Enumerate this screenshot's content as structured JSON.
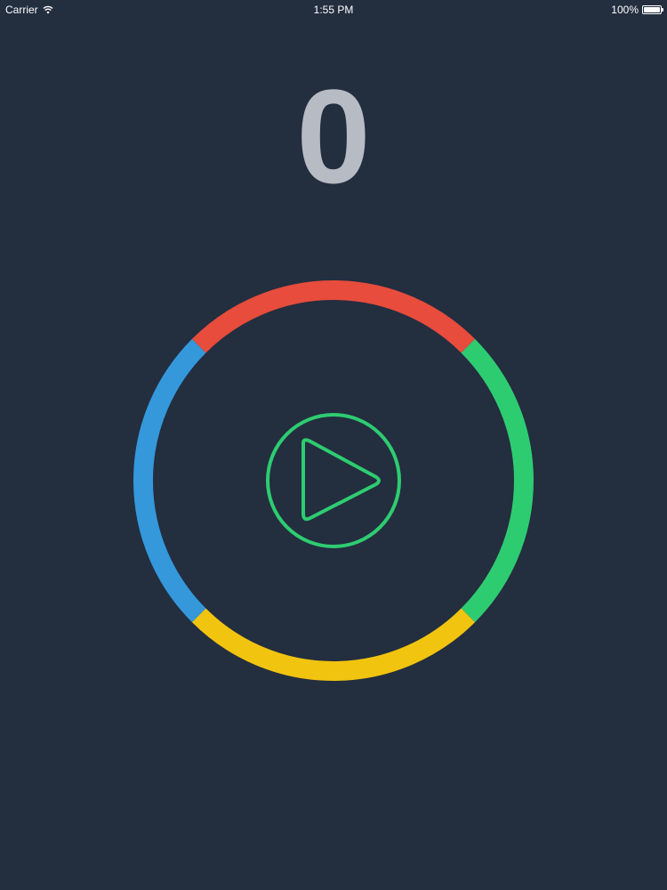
{
  "status_bar": {
    "carrier": "Carrier",
    "time": "1:55 PM",
    "battery": "100%",
    "wifi_icon": "wifi-icon",
    "battery_icon": "battery-icon"
  },
  "game": {
    "score": "0",
    "ring_segments": [
      {
        "name": "red",
        "color": "#e74c3c"
      },
      {
        "name": "green",
        "color": "#2ecc71"
      },
      {
        "name": "yellow",
        "color": "#f1c40f"
      },
      {
        "name": "blue",
        "color": "#3498db"
      }
    ],
    "play_button": {
      "icon": "play-icon",
      "color": "#2ecc71"
    }
  },
  "colors": {
    "background": "#232e3f",
    "score_text": "#b7bcc4",
    "status_text": "#ffffff"
  }
}
